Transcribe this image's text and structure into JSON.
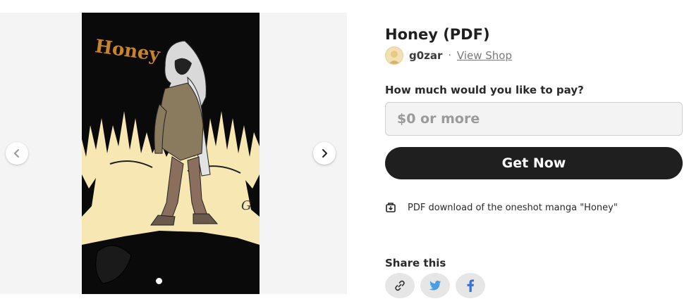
{
  "product": {
    "title": "Honey (PDF)",
    "creator": "g0zar",
    "separator": "·",
    "view_shop": "View Shop",
    "cover_logo_text": "Honey",
    "cover_signature": "G"
  },
  "purchase": {
    "price_question": "How much would you like to pay?",
    "price_placeholder": "$0 or more",
    "button_label": "Get Now"
  },
  "description": "PDF download of the oneshot manga \"Honey\"",
  "share": {
    "label": "Share this",
    "buttons": [
      "link-icon",
      "twitter-icon",
      "facebook-icon"
    ]
  },
  "colors": {
    "button_bg": "#1f1f1f",
    "twitter": "#4a9fe3",
    "facebook": "#3b6fd9",
    "cover_bg": "#f6e7b3"
  }
}
